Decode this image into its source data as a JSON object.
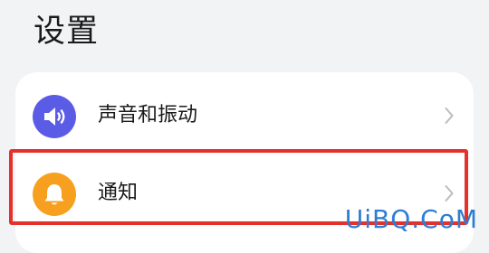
{
  "header": {
    "title": "设置"
  },
  "settings": {
    "items": [
      {
        "label": "声音和振动",
        "icon": "speaker-icon",
        "icon_color": "#5b5ce6"
      },
      {
        "label": "通知",
        "icon": "bell-icon",
        "icon_color": "#f7a020"
      }
    ]
  },
  "highlight": {
    "color": "#e5312c"
  },
  "watermark": {
    "text": "UiBQ.CoM",
    "color": "#2f7dd3"
  }
}
